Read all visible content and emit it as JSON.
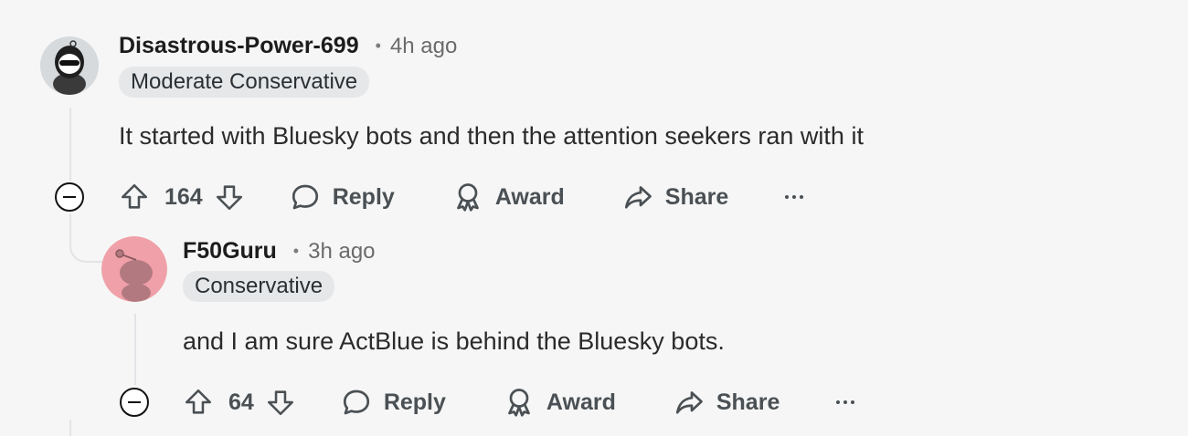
{
  "comments": [
    {
      "username": "Disastrous-Power-699",
      "time": "4h ago",
      "flair": "Moderate Conservative",
      "body": "It started with Bluesky bots and then the attention seekers ran with it",
      "score": "164",
      "reply_label": "Reply",
      "award_label": "Award",
      "share_label": "Share"
    },
    {
      "username": "F50Guru",
      "time": "3h ago",
      "flair": "Conservative",
      "body": "and I am sure ActBlue is behind the Bluesky bots.",
      "score": "64",
      "reply_label": "Reply",
      "award_label": "Award",
      "share_label": "Share"
    }
  ],
  "separator": "•",
  "colors": {
    "background": "#f6f6f6",
    "flair_bg": "#e5e7e9",
    "thread_line": "#e2e4e6",
    "avatar2_bg": "#f0a0a8"
  }
}
